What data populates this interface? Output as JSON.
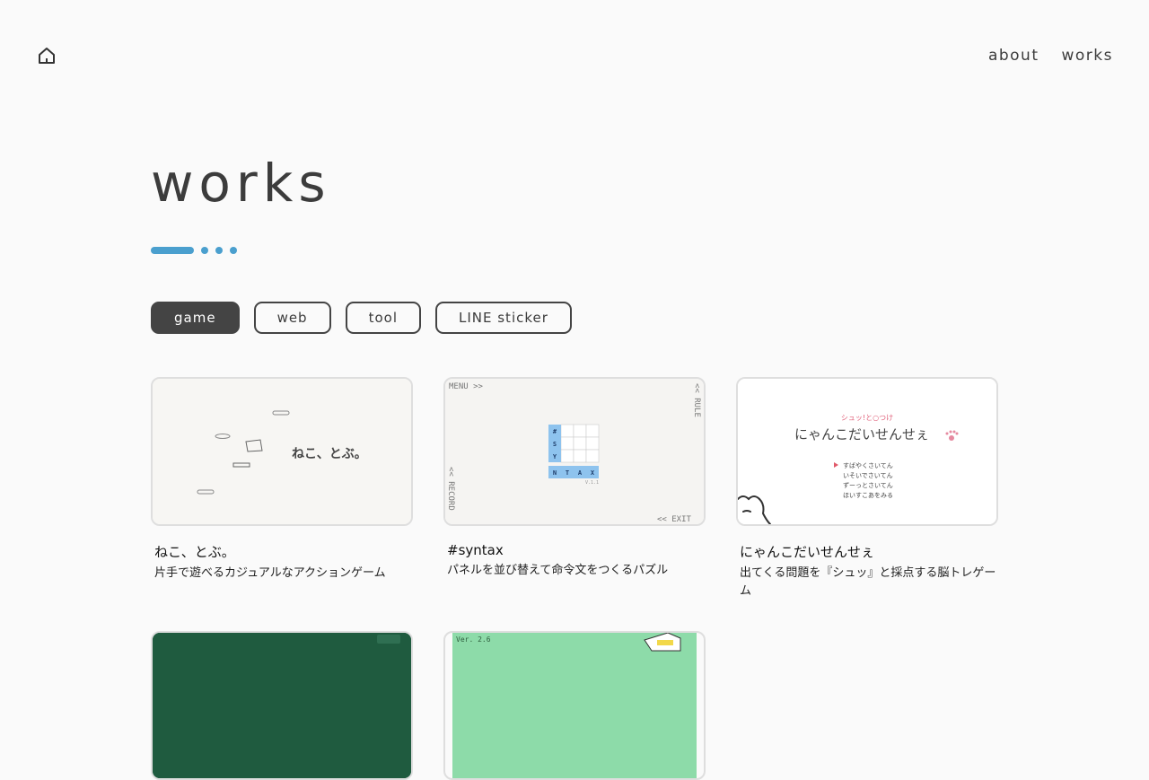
{
  "nav": {
    "about": "about",
    "works": "works"
  },
  "page_title": "works",
  "filters": [
    "game",
    "web",
    "tool",
    "LINE sticker"
  ],
  "cards": [
    {
      "title": "ねこ、とぶ。",
      "desc": "片手で遊べるカジュアルなアクションゲーム",
      "thumb_text": "ねこ、とぶ。"
    },
    {
      "title": "#syntax",
      "desc": "パネルを並び替えて命令文をつくるパズル",
      "thumb": {
        "menu": "MENU >>",
        "rule": "<< RULE",
        "record": "<< RECORD",
        "exit": "<< EXIT",
        "version": "V.1.1",
        "tiles": [
          "#",
          "S",
          "Y",
          "N",
          "T",
          "A",
          "X"
        ]
      }
    },
    {
      "title": "にゃんこだいせんせぇ",
      "desc": "出てくる問題を『シュッ』と採点する脳トレゲーム",
      "thumb": {
        "top": "シュッ!と○つけ",
        "title": "にゃんこだいせんせぇ",
        "menu": [
          "すばやくさいてん",
          "いそいでさいてん",
          "ずーっとさいてん",
          "ほいすこあをみる"
        ]
      }
    },
    {
      "title": "",
      "desc": "",
      "thumb": {}
    },
    {
      "title": "",
      "desc": "",
      "thumb": {
        "version": "Ver. 2.6"
      }
    }
  ],
  "colors": {
    "accent": "#4a9fce",
    "active_filter": "#444444",
    "background": "#fafafa"
  }
}
